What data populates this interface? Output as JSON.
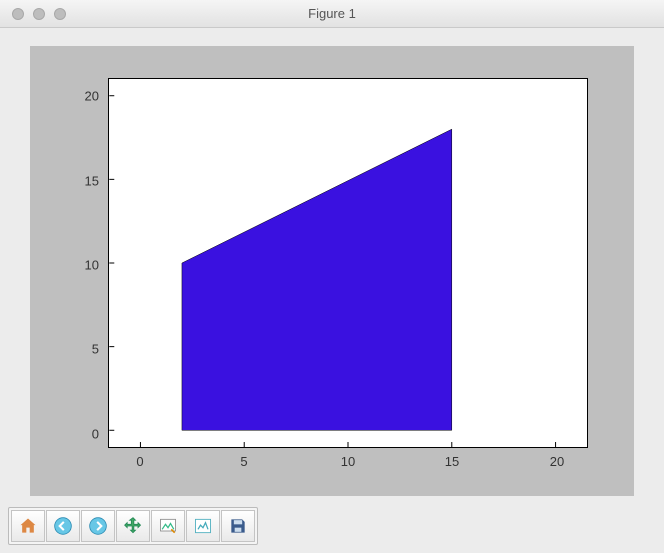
{
  "window": {
    "title": "Figure 1"
  },
  "chart_data": {
    "type": "area",
    "polygon_vertices": [
      {
        "x": 2,
        "y": 0
      },
      {
        "x": 15,
        "y": 0
      },
      {
        "x": 15,
        "y": 18
      },
      {
        "x": 2,
        "y": 10
      }
    ],
    "fill_color": "#3a11e0",
    "xlim": [
      -1.5,
      21.5
    ],
    "ylim": [
      -1,
      21
    ],
    "xticks": [
      0,
      5,
      10,
      15,
      20
    ],
    "yticks": [
      0,
      5,
      10,
      15,
      20
    ],
    "xtick_labels": {
      "t0": "0",
      "t1": "5",
      "t2": "10",
      "t3": "15",
      "t4": "20"
    },
    "ytick_labels": {
      "t0": "0",
      "t1": "5",
      "t2": "10",
      "t3": "15",
      "t4": "20"
    },
    "title": "",
    "xlabel": "",
    "ylabel": ""
  },
  "toolbar": {
    "home": "Home",
    "back": "Back",
    "forward": "Forward",
    "pan": "Pan",
    "zoom": "Zoom",
    "subplots": "Configure subplots",
    "save": "Save"
  }
}
